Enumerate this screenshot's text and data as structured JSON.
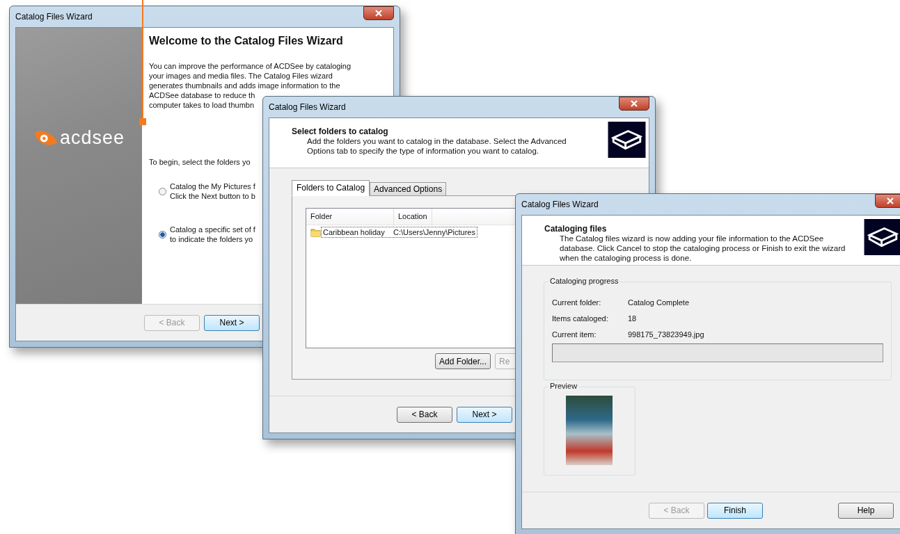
{
  "windows": [
    {
      "kind": "welcome",
      "title": "Catalog Files Wizard",
      "logo": "acdsee",
      "heading": "Welcome to the Catalog Files Wizard",
      "intro_lines": [
        "You can improve the performance of ACDSee by cataloging",
        "your images and media files. The Catalog Files wizard",
        "generates thumbnails and adds image information to the",
        "ACDSee database to reduce th",
        "computer takes to load thumbn"
      ],
      "prompt": "To begin, select the folders yo",
      "options": [
        {
          "lines": [
            "Catalog the My Pictures f",
            "Click the Next button to b"
          ],
          "selected": false
        },
        {
          "lines": [
            "Catalog a specific set of f",
            "to indicate the folders yo"
          ],
          "selected": true
        }
      ],
      "buttons": [
        {
          "label": "< Back",
          "disabled": true,
          "default": false
        },
        {
          "label": "Next >",
          "disabled": false,
          "default": true
        }
      ]
    },
    {
      "kind": "select",
      "title": "Catalog Files Wizard",
      "heading": "Select folders to catalog",
      "description_lines": [
        "Add the folders you want to catalog in the database. Select the Advanced",
        "Options tab to specify the type of information you want to catalog."
      ],
      "tabs": [
        {
          "label": "Folders to Catalog",
          "selected": true
        },
        {
          "label": "Advanced Options",
          "selected": false
        }
      ],
      "table": {
        "columns": [
          "Folder",
          "Location"
        ],
        "rows": [
          {
            "cells": [
              "Caribbean holiday",
              "C:\\Users\\Jenny\\Pictures"
            ],
            "selected": true
          }
        ]
      },
      "list_buttons": [
        {
          "label": "Add Folder...",
          "disabled": false
        },
        {
          "label": "Re",
          "disabled": true
        }
      ],
      "buttons": [
        {
          "label": "< Back",
          "disabled": false,
          "default": false
        },
        {
          "label": "Next >",
          "disabled": false,
          "default": true
        }
      ]
    },
    {
      "kind": "progress",
      "title": "Catalog Files Wizard",
      "heading": "Cataloging files",
      "description_lines": [
        "The Catalog files wizard is now adding your file information to the ACDSee",
        "database. Click Cancel to stop the cataloging process or Finish to exit the wizard",
        "when the cataloging process is done."
      ],
      "progress_group": {
        "title": "Cataloging progress",
        "fields": [
          {
            "label": "Current folder:",
            "value": "Catalog Complete"
          },
          {
            "label": "Items cataloged:",
            "value": "18"
          },
          {
            "label": "Current item:",
            "value": "998175_73823949.jpg"
          }
        ],
        "level": 0
      },
      "preview": {
        "title": "Preview"
      },
      "buttons": [
        {
          "label": "< Back",
          "disabled": true,
          "default": false
        },
        {
          "label": "Finish",
          "disabled": false,
          "default": true
        },
        {
          "label": "Help",
          "disabled": false,
          "default": false
        }
      ]
    }
  ]
}
